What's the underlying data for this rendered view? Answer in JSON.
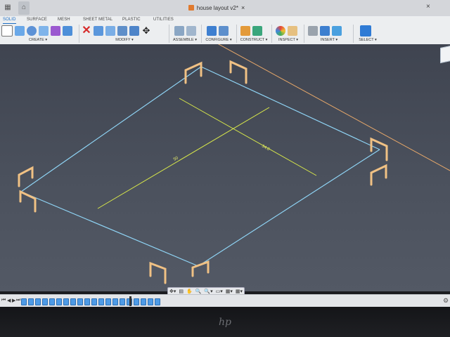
{
  "window": {
    "document_title": "house layout v2*",
    "tab_close_glyph": "×",
    "close_glyph": "×"
  },
  "ribbon": {
    "tabs": [
      {
        "label": "SOLID",
        "active": true
      },
      {
        "label": "SURFACE",
        "active": false
      },
      {
        "label": "MESH",
        "active": false
      },
      {
        "label": "SHEET METAL",
        "active": false
      },
      {
        "label": "PLASTIC",
        "active": false
      },
      {
        "label": "UTILITIES",
        "active": false
      }
    ],
    "groups": [
      {
        "label": "CREATE ▾",
        "icons": [
          "new-component-icon",
          "extrude-icon",
          "revolve-icon",
          "sweep-icon",
          "form-icon"
        ]
      },
      {
        "label": "MODIFY ▾",
        "icons": [
          "delete-icon",
          "press-pull-icon",
          "fillet-icon",
          "shell-icon",
          "combine-icon",
          "move-icon"
        ]
      },
      {
        "label": "ASSEMBLE ▾",
        "icons": [
          "joint-icon",
          "as-built-joint-icon"
        ]
      },
      {
        "label": "CONFIGURE ▾",
        "icons": [
          "configure-icon",
          "parameters-icon"
        ]
      },
      {
        "label": "CONSTRUCT ▾",
        "icons": [
          "offset-plane-icon",
          "midplane-icon"
        ]
      },
      {
        "label": "INSPECT ▾",
        "icons": [
          "inspect-icon",
          "measure-icon"
        ]
      },
      {
        "label": "INSERT ▾",
        "icons": [
          "insert-derive-icon",
          "insert-mesh-icon",
          "canvas-icon"
        ]
      },
      {
        "label": "SELECT ▾",
        "icons": [
          "select-icon"
        ]
      }
    ]
  },
  "viewport": {
    "dimension_labels": [
      "50",
      "34.0"
    ]
  },
  "navbar": {
    "items": [
      "✥▾",
      "▤",
      "✋",
      "🔍",
      "🔍▾",
      "▭▾",
      "▦▾",
      "▦▾"
    ]
  },
  "timeline": {
    "controls": [
      "⏮",
      "◀",
      "▶",
      "⏭"
    ],
    "feature_count": 20,
    "settings_glyph": "⚙"
  },
  "bezel": {
    "logo": "hp"
  },
  "colors": {
    "sketch_line": "#8fd4f5",
    "center_line": "#d8e84a",
    "post": "#f0c184",
    "axis_line": "#e7a86a",
    "accent": "#1e6fc4"
  }
}
